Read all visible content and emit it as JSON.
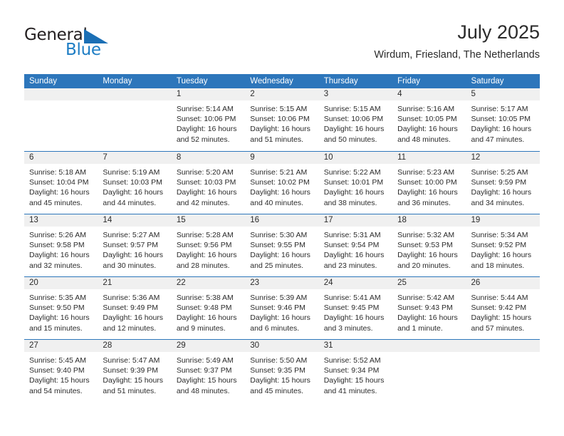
{
  "brand": {
    "name_part1": "General",
    "name_part2": "Blue",
    "logo_icon": "triangle-logo-icon"
  },
  "header": {
    "title": "July 2025",
    "location": "Wirdum, Friesland, The Netherlands"
  },
  "colors": {
    "header_blue": "#2d76bb",
    "day_band_gray": "#f0f0f0",
    "brand_blue": "#1d7dc4",
    "text": "#2b2b2b"
  },
  "weekdays": [
    "Sunday",
    "Monday",
    "Tuesday",
    "Wednesday",
    "Thursday",
    "Friday",
    "Saturday"
  ],
  "weeks": [
    [
      {
        "day": "",
        "empty": true,
        "sunrise": "",
        "sunset": "",
        "daylight_l1": "",
        "daylight_l2": ""
      },
      {
        "day": "",
        "empty": true,
        "sunrise": "",
        "sunset": "",
        "daylight_l1": "",
        "daylight_l2": ""
      },
      {
        "day": "1",
        "sunrise": "Sunrise: 5:14 AM",
        "sunset": "Sunset: 10:06 PM",
        "daylight_l1": "Daylight: 16 hours",
        "daylight_l2": "and 52 minutes."
      },
      {
        "day": "2",
        "sunrise": "Sunrise: 5:15 AM",
        "sunset": "Sunset: 10:06 PM",
        "daylight_l1": "Daylight: 16 hours",
        "daylight_l2": "and 51 minutes."
      },
      {
        "day": "3",
        "sunrise": "Sunrise: 5:15 AM",
        "sunset": "Sunset: 10:06 PM",
        "daylight_l1": "Daylight: 16 hours",
        "daylight_l2": "and 50 minutes."
      },
      {
        "day": "4",
        "sunrise": "Sunrise: 5:16 AM",
        "sunset": "Sunset: 10:05 PM",
        "daylight_l1": "Daylight: 16 hours",
        "daylight_l2": "and 48 minutes."
      },
      {
        "day": "5",
        "sunrise": "Sunrise: 5:17 AM",
        "sunset": "Sunset: 10:05 PM",
        "daylight_l1": "Daylight: 16 hours",
        "daylight_l2": "and 47 minutes."
      }
    ],
    [
      {
        "day": "6",
        "sunrise": "Sunrise: 5:18 AM",
        "sunset": "Sunset: 10:04 PM",
        "daylight_l1": "Daylight: 16 hours",
        "daylight_l2": "and 45 minutes."
      },
      {
        "day": "7",
        "sunrise": "Sunrise: 5:19 AM",
        "sunset": "Sunset: 10:03 PM",
        "daylight_l1": "Daylight: 16 hours",
        "daylight_l2": "and 44 minutes."
      },
      {
        "day": "8",
        "sunrise": "Sunrise: 5:20 AM",
        "sunset": "Sunset: 10:03 PM",
        "daylight_l1": "Daylight: 16 hours",
        "daylight_l2": "and 42 minutes."
      },
      {
        "day": "9",
        "sunrise": "Sunrise: 5:21 AM",
        "sunset": "Sunset: 10:02 PM",
        "daylight_l1": "Daylight: 16 hours",
        "daylight_l2": "and 40 minutes."
      },
      {
        "day": "10",
        "sunrise": "Sunrise: 5:22 AM",
        "sunset": "Sunset: 10:01 PM",
        "daylight_l1": "Daylight: 16 hours",
        "daylight_l2": "and 38 minutes."
      },
      {
        "day": "11",
        "sunrise": "Sunrise: 5:23 AM",
        "sunset": "Sunset: 10:00 PM",
        "daylight_l1": "Daylight: 16 hours",
        "daylight_l2": "and 36 minutes."
      },
      {
        "day": "12",
        "sunrise": "Sunrise: 5:25 AM",
        "sunset": "Sunset: 9:59 PM",
        "daylight_l1": "Daylight: 16 hours",
        "daylight_l2": "and 34 minutes."
      }
    ],
    [
      {
        "day": "13",
        "sunrise": "Sunrise: 5:26 AM",
        "sunset": "Sunset: 9:58 PM",
        "daylight_l1": "Daylight: 16 hours",
        "daylight_l2": "and 32 minutes."
      },
      {
        "day": "14",
        "sunrise": "Sunrise: 5:27 AM",
        "sunset": "Sunset: 9:57 PM",
        "daylight_l1": "Daylight: 16 hours",
        "daylight_l2": "and 30 minutes."
      },
      {
        "day": "15",
        "sunrise": "Sunrise: 5:28 AM",
        "sunset": "Sunset: 9:56 PM",
        "daylight_l1": "Daylight: 16 hours",
        "daylight_l2": "and 28 minutes."
      },
      {
        "day": "16",
        "sunrise": "Sunrise: 5:30 AM",
        "sunset": "Sunset: 9:55 PM",
        "daylight_l1": "Daylight: 16 hours",
        "daylight_l2": "and 25 minutes."
      },
      {
        "day": "17",
        "sunrise": "Sunrise: 5:31 AM",
        "sunset": "Sunset: 9:54 PM",
        "daylight_l1": "Daylight: 16 hours",
        "daylight_l2": "and 23 minutes."
      },
      {
        "day": "18",
        "sunrise": "Sunrise: 5:32 AM",
        "sunset": "Sunset: 9:53 PM",
        "daylight_l1": "Daylight: 16 hours",
        "daylight_l2": "and 20 minutes."
      },
      {
        "day": "19",
        "sunrise": "Sunrise: 5:34 AM",
        "sunset": "Sunset: 9:52 PM",
        "daylight_l1": "Daylight: 16 hours",
        "daylight_l2": "and 18 minutes."
      }
    ],
    [
      {
        "day": "20",
        "sunrise": "Sunrise: 5:35 AM",
        "sunset": "Sunset: 9:50 PM",
        "daylight_l1": "Daylight: 16 hours",
        "daylight_l2": "and 15 minutes."
      },
      {
        "day": "21",
        "sunrise": "Sunrise: 5:36 AM",
        "sunset": "Sunset: 9:49 PM",
        "daylight_l1": "Daylight: 16 hours",
        "daylight_l2": "and 12 minutes."
      },
      {
        "day": "22",
        "sunrise": "Sunrise: 5:38 AM",
        "sunset": "Sunset: 9:48 PM",
        "daylight_l1": "Daylight: 16 hours",
        "daylight_l2": "and 9 minutes."
      },
      {
        "day": "23",
        "sunrise": "Sunrise: 5:39 AM",
        "sunset": "Sunset: 9:46 PM",
        "daylight_l1": "Daylight: 16 hours",
        "daylight_l2": "and 6 minutes."
      },
      {
        "day": "24",
        "sunrise": "Sunrise: 5:41 AM",
        "sunset": "Sunset: 9:45 PM",
        "daylight_l1": "Daylight: 16 hours",
        "daylight_l2": "and 3 minutes."
      },
      {
        "day": "25",
        "sunrise": "Sunrise: 5:42 AM",
        "sunset": "Sunset: 9:43 PM",
        "daylight_l1": "Daylight: 16 hours",
        "daylight_l2": "and 1 minute."
      },
      {
        "day": "26",
        "sunrise": "Sunrise: 5:44 AM",
        "sunset": "Sunset: 9:42 PM",
        "daylight_l1": "Daylight: 15 hours",
        "daylight_l2": "and 57 minutes."
      }
    ],
    [
      {
        "day": "27",
        "sunrise": "Sunrise: 5:45 AM",
        "sunset": "Sunset: 9:40 PM",
        "daylight_l1": "Daylight: 15 hours",
        "daylight_l2": "and 54 minutes."
      },
      {
        "day": "28",
        "sunrise": "Sunrise: 5:47 AM",
        "sunset": "Sunset: 9:39 PM",
        "daylight_l1": "Daylight: 15 hours",
        "daylight_l2": "and 51 minutes."
      },
      {
        "day": "29",
        "sunrise": "Sunrise: 5:49 AM",
        "sunset": "Sunset: 9:37 PM",
        "daylight_l1": "Daylight: 15 hours",
        "daylight_l2": "and 48 minutes."
      },
      {
        "day": "30",
        "sunrise": "Sunrise: 5:50 AM",
        "sunset": "Sunset: 9:35 PM",
        "daylight_l1": "Daylight: 15 hours",
        "daylight_l2": "and 45 minutes."
      },
      {
        "day": "31",
        "sunrise": "Sunrise: 5:52 AM",
        "sunset": "Sunset: 9:34 PM",
        "daylight_l1": "Daylight: 15 hours",
        "daylight_l2": "and 41 minutes."
      },
      {
        "day": "",
        "empty": true,
        "sunrise": "",
        "sunset": "",
        "daylight_l1": "",
        "daylight_l2": ""
      },
      {
        "day": "",
        "empty": true,
        "sunrise": "",
        "sunset": "",
        "daylight_l1": "",
        "daylight_l2": ""
      }
    ]
  ]
}
